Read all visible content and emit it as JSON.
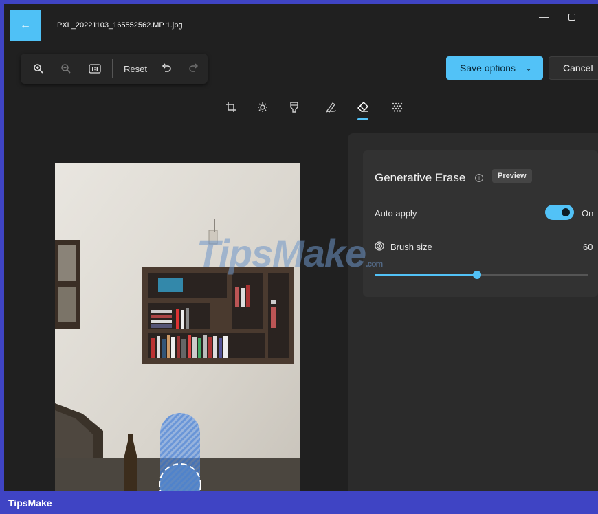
{
  "window": {
    "title": "PXL_20221103_165552562.MP 1.jpg",
    "accent": "#52c2f7"
  },
  "toolbar": {
    "reset_label": "Reset",
    "icons": [
      "zoom-in-icon",
      "zoom-out-icon",
      "actual-size-icon",
      "undo-icon",
      "redo-icon"
    ]
  },
  "actions": {
    "save_label": "Save options",
    "cancel_label": "Cancel"
  },
  "tools": [
    "crop-icon",
    "brightness-icon",
    "filter-icon",
    "markup-icon",
    "erase-icon",
    "background-blur-icon"
  ],
  "panel": {
    "title": "Generative Erase",
    "badge": "Preview",
    "auto_apply_label": "Auto apply",
    "auto_apply_state": "On",
    "auto_apply_on": true,
    "brush_size_label": "Brush size",
    "brush_size_value": "60",
    "brush_size_fraction": 0.48
  },
  "watermark": {
    "text": "TipsMake",
    "suffix": ".com"
  },
  "footer": {
    "brand": "TipsMake"
  }
}
